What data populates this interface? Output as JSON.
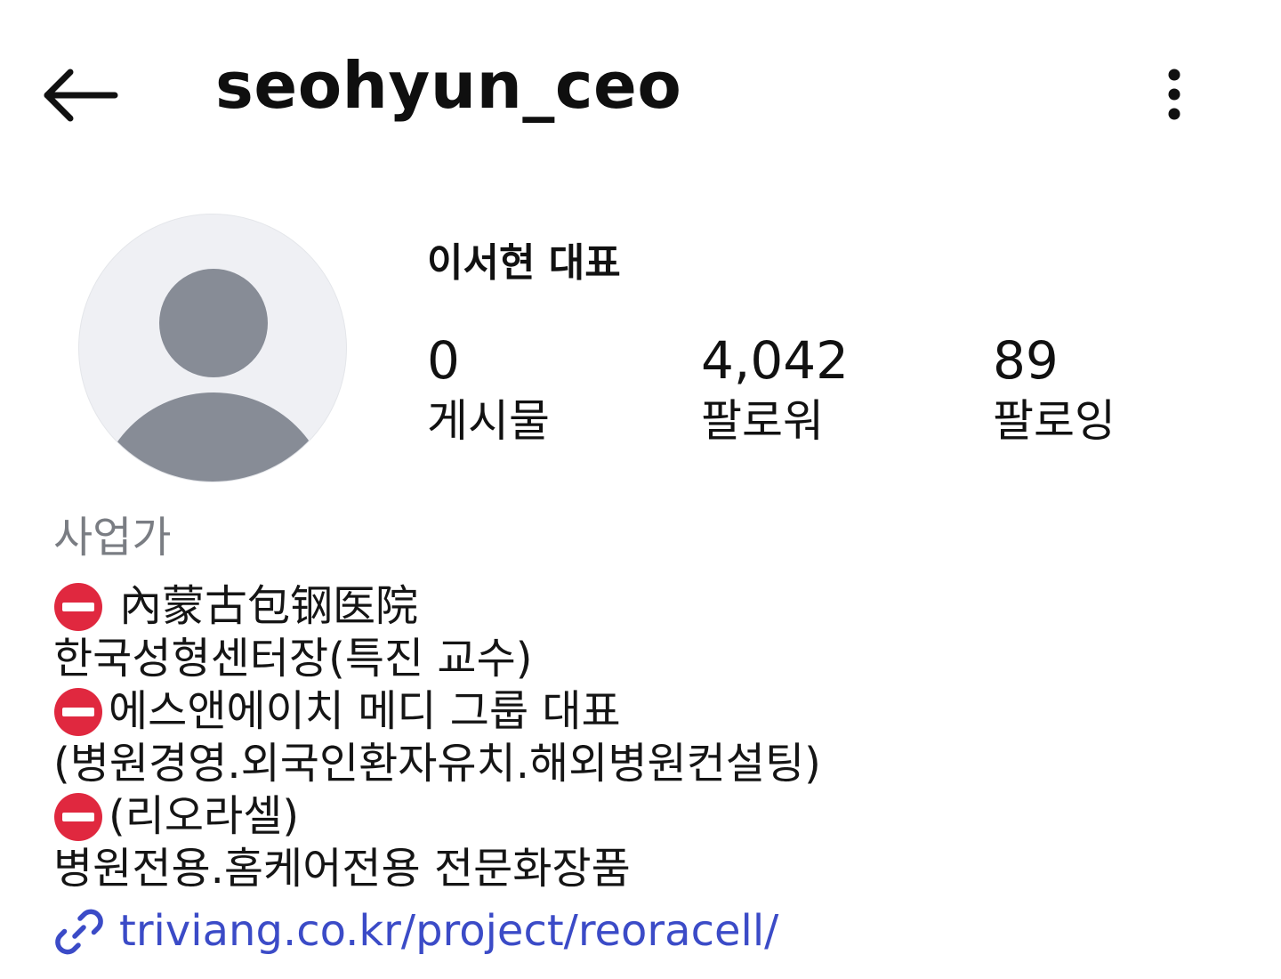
{
  "header": {
    "username": "seohyun_ceo"
  },
  "profile": {
    "display_name": "이서현 대표",
    "stats": {
      "posts": {
        "value": "0",
        "label": "게시물"
      },
      "followers": {
        "value": "4,042",
        "label": "팔로워"
      },
      "following": {
        "value": "89",
        "label": "팔로잉"
      }
    }
  },
  "bio": {
    "category": "사업가",
    "lines": [
      {
        "icon": "no-entry-icon",
        "text": "內蒙古包钢医院"
      },
      {
        "icon": "",
        "text": "한국성형센터장(특진 교수)"
      },
      {
        "icon": "no-entry-icon",
        "text": "에스앤에이치 메디 그룹 대표"
      },
      {
        "icon": "",
        "text": "(병원경영.외국인환자유치.해외병원컨설팅)"
      },
      {
        "icon": "no-entry-icon",
        "text": "(리오라셀)"
      },
      {
        "icon": "",
        "text": "병원전용.홈케어전용 전문화장품"
      }
    ],
    "link": "triviang.co.kr/project/reoracell/"
  },
  "colors": {
    "link": "#3b4bc7",
    "category": "#7a7d83",
    "avatar_bg": "#eff0f4",
    "avatar_silhouette": "#878c96",
    "no_entry_red": "#e0283f"
  }
}
